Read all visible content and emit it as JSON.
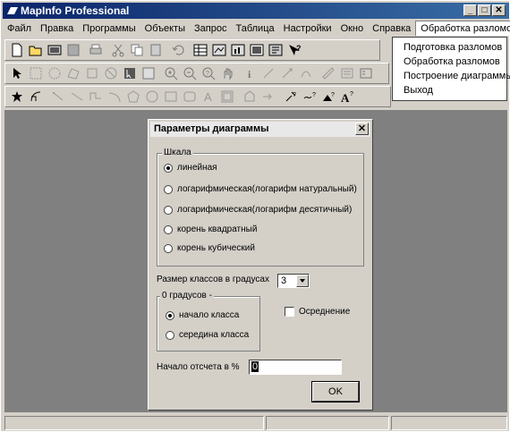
{
  "app": {
    "title": "MapInfo Professional"
  },
  "window_buttons": {
    "minimize": "_",
    "maximize": "□",
    "close": "✕"
  },
  "menu": [
    "Файл",
    "Правка",
    "Программы",
    "Объекты",
    "Запрос",
    "Таблица",
    "Настройки",
    "Окно",
    "Справка",
    "Обработка разломов"
  ],
  "dropdown": [
    "Подготовка разломов",
    "Обработка разломов",
    "Построение диаграммы",
    "Выход"
  ],
  "dialog": {
    "title": "Параметры диаграммы",
    "close": "✕",
    "scale_group": "Шкала",
    "scale_options": [
      "линейная",
      "логарифмическая(логарифм натуральный)",
      "логарифмическая(логарифм десятичный)",
      "корень квадратный",
      "корень кубический"
    ],
    "scale_selected": 0,
    "class_size_label": "Размер классов  в  градусах",
    "class_size_value": "3",
    "zero_group": "0 градусов -",
    "zero_options": [
      "начало класса",
      "середина класса"
    ],
    "zero_selected": 0,
    "averaging_label": "Осреднение",
    "averaging_checked": false,
    "origin_label": "Начало отсчета в %",
    "origin_value": "0",
    "ok_label": "OK"
  },
  "colors": {
    "title_bar": "#0a246a",
    "workspace": "#808080",
    "face": "#d4d0c8"
  }
}
